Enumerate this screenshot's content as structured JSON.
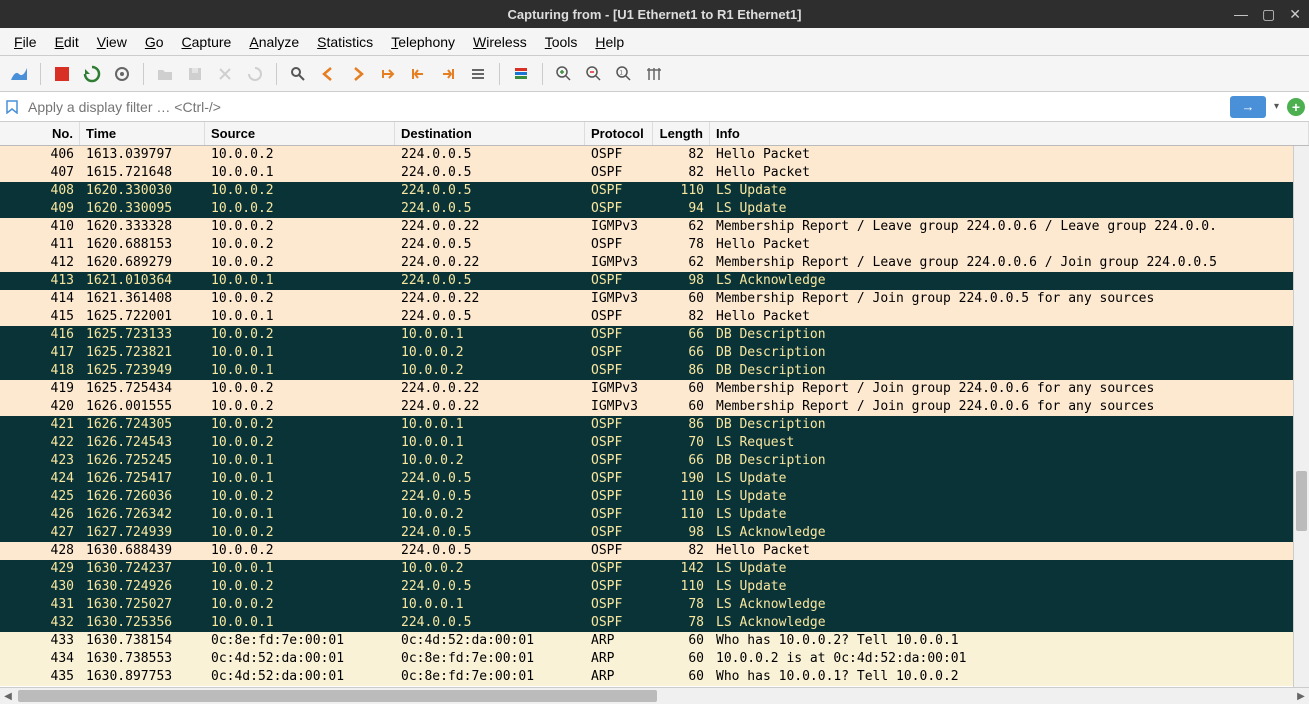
{
  "title": "Capturing from - [U1 Ethernet1 to R1 Ethernet1]",
  "menu": [
    "File",
    "Edit",
    "View",
    "Go",
    "Capture",
    "Analyze",
    "Statistics",
    "Telephony",
    "Wireless",
    "Tools",
    "Help"
  ],
  "menu_ul": [
    "F",
    "E",
    "V",
    "G",
    "C",
    "A",
    "S",
    "T",
    "W",
    "T",
    "H"
  ],
  "filter": {
    "placeholder": "Apply a display filter … <Ctrl-/>"
  },
  "columns": [
    "No.",
    "Time",
    "Source",
    "Destination",
    "Protocol",
    "Length",
    "Info"
  ],
  "packets": [
    {
      "no": "406",
      "time": "1613.039797",
      "src": "10.0.0.2",
      "dst": "224.0.0.5",
      "proto": "OSPF",
      "len": "82",
      "info": "Hello Packet",
      "style": "normal"
    },
    {
      "no": "407",
      "time": "1615.721648",
      "src": "10.0.0.1",
      "dst": "224.0.0.5",
      "proto": "OSPF",
      "len": "82",
      "info": "Hello Packet",
      "style": "normal"
    },
    {
      "no": "408",
      "time": "1620.330030",
      "src": "10.0.0.2",
      "dst": "224.0.0.5",
      "proto": "OSPF",
      "len": "110",
      "info": "LS Update",
      "style": "highlight"
    },
    {
      "no": "409",
      "time": "1620.330095",
      "src": "10.0.0.2",
      "dst": "224.0.0.5",
      "proto": "OSPF",
      "len": "94",
      "info": "LS Update",
      "style": "highlight"
    },
    {
      "no": "410",
      "time": "1620.333328",
      "src": "10.0.0.2",
      "dst": "224.0.0.22",
      "proto": "IGMPv3",
      "len": "62",
      "info": "Membership Report / Leave group 224.0.0.6 / Leave group 224.0.0.",
      "style": "normal"
    },
    {
      "no": "411",
      "time": "1620.688153",
      "src": "10.0.0.2",
      "dst": "224.0.0.5",
      "proto": "OSPF",
      "len": "78",
      "info": "Hello Packet",
      "style": "normal"
    },
    {
      "no": "412",
      "time": "1620.689279",
      "src": "10.0.0.2",
      "dst": "224.0.0.22",
      "proto": "IGMPv3",
      "len": "62",
      "info": "Membership Report / Leave group 224.0.0.6 / Join group 224.0.0.5",
      "style": "normal"
    },
    {
      "no": "413",
      "time": "1621.010364",
      "src": "10.0.0.1",
      "dst": "224.0.0.5",
      "proto": "OSPF",
      "len": "98",
      "info": "LS Acknowledge",
      "style": "highlight"
    },
    {
      "no": "414",
      "time": "1621.361408",
      "src": "10.0.0.2",
      "dst": "224.0.0.22",
      "proto": "IGMPv3",
      "len": "60",
      "info": "Membership Report / Join group 224.0.0.5 for any sources",
      "style": "normal"
    },
    {
      "no": "415",
      "time": "1625.722001",
      "src": "10.0.0.1",
      "dst": "224.0.0.5",
      "proto": "OSPF",
      "len": "82",
      "info": "Hello Packet",
      "style": "normal"
    },
    {
      "no": "416",
      "time": "1625.723133",
      "src": "10.0.0.2",
      "dst": "10.0.0.1",
      "proto": "OSPF",
      "len": "66",
      "info": "DB Description",
      "style": "highlight"
    },
    {
      "no": "417",
      "time": "1625.723821",
      "src": "10.0.0.1",
      "dst": "10.0.0.2",
      "proto": "OSPF",
      "len": "66",
      "info": "DB Description",
      "style": "highlight"
    },
    {
      "no": "418",
      "time": "1625.723949",
      "src": "10.0.0.1",
      "dst": "10.0.0.2",
      "proto": "OSPF",
      "len": "86",
      "info": "DB Description",
      "style": "highlight"
    },
    {
      "no": "419",
      "time": "1625.725434",
      "src": "10.0.0.2",
      "dst": "224.0.0.22",
      "proto": "IGMPv3",
      "len": "60",
      "info": "Membership Report / Join group 224.0.0.6 for any sources",
      "style": "normal"
    },
    {
      "no": "420",
      "time": "1626.001555",
      "src": "10.0.0.2",
      "dst": "224.0.0.22",
      "proto": "IGMPv3",
      "len": "60",
      "info": "Membership Report / Join group 224.0.0.6 for any sources",
      "style": "normal"
    },
    {
      "no": "421",
      "time": "1626.724305",
      "src": "10.0.0.2",
      "dst": "10.0.0.1",
      "proto": "OSPF",
      "len": "86",
      "info": "DB Description",
      "style": "highlight"
    },
    {
      "no": "422",
      "time": "1626.724543",
      "src": "10.0.0.2",
      "dst": "10.0.0.1",
      "proto": "OSPF",
      "len": "70",
      "info": "LS Request",
      "style": "highlight"
    },
    {
      "no": "423",
      "time": "1626.725245",
      "src": "10.0.0.1",
      "dst": "10.0.0.2",
      "proto": "OSPF",
      "len": "66",
      "info": "DB Description",
      "style": "highlight"
    },
    {
      "no": "424",
      "time": "1626.725417",
      "src": "10.0.0.1",
      "dst": "224.0.0.5",
      "proto": "OSPF",
      "len": "190",
      "info": "LS Update",
      "style": "highlight"
    },
    {
      "no": "425",
      "time": "1626.726036",
      "src": "10.0.0.2",
      "dst": "224.0.0.5",
      "proto": "OSPF",
      "len": "110",
      "info": "LS Update",
      "style": "highlight"
    },
    {
      "no": "426",
      "time": "1626.726342",
      "src": "10.0.0.1",
      "dst": "10.0.0.2",
      "proto": "OSPF",
      "len": "110",
      "info": "LS Update",
      "style": "highlight"
    },
    {
      "no": "427",
      "time": "1627.724939",
      "src": "10.0.0.2",
      "dst": "224.0.0.5",
      "proto": "OSPF",
      "len": "98",
      "info": "LS Acknowledge",
      "style": "highlight"
    },
    {
      "no": "428",
      "time": "1630.688439",
      "src": "10.0.0.2",
      "dst": "224.0.0.5",
      "proto": "OSPF",
      "len": "82",
      "info": "Hello Packet",
      "style": "normal"
    },
    {
      "no": "429",
      "time": "1630.724237",
      "src": "10.0.0.1",
      "dst": "10.0.0.2",
      "proto": "OSPF",
      "len": "142",
      "info": "LS Update",
      "style": "highlight"
    },
    {
      "no": "430",
      "time": "1630.724926",
      "src": "10.0.0.2",
      "dst": "224.0.0.5",
      "proto": "OSPF",
      "len": "110",
      "info": "LS Update",
      "style": "highlight"
    },
    {
      "no": "431",
      "time": "1630.725027",
      "src": "10.0.0.2",
      "dst": "10.0.0.1",
      "proto": "OSPF",
      "len": "78",
      "info": "LS Acknowledge",
      "style": "highlight"
    },
    {
      "no": "432",
      "time": "1630.725356",
      "src": "10.0.0.1",
      "dst": "224.0.0.5",
      "proto": "OSPF",
      "len": "78",
      "info": "LS Acknowledge",
      "style": "highlight"
    },
    {
      "no": "433",
      "time": "1630.738154",
      "src": "0c:8e:fd:7e:00:01",
      "dst": "0c:4d:52:da:00:01",
      "proto": "ARP",
      "len": "60",
      "info": "Who has 10.0.0.2? Tell 10.0.0.1",
      "style": "arp"
    },
    {
      "no": "434",
      "time": "1630.738553",
      "src": "0c:4d:52:da:00:01",
      "dst": "0c:8e:fd:7e:00:01",
      "proto": "ARP",
      "len": "60",
      "info": "10.0.0.2 is at 0c:4d:52:da:00:01",
      "style": "arp"
    },
    {
      "no": "435",
      "time": "1630.897753",
      "src": "0c:4d:52:da:00:01",
      "dst": "0c:8e:fd:7e:00:01",
      "proto": "ARP",
      "len": "60",
      "info": "Who has 10.0.0.1? Tell 10.0.0.2",
      "style": "arp"
    }
  ]
}
